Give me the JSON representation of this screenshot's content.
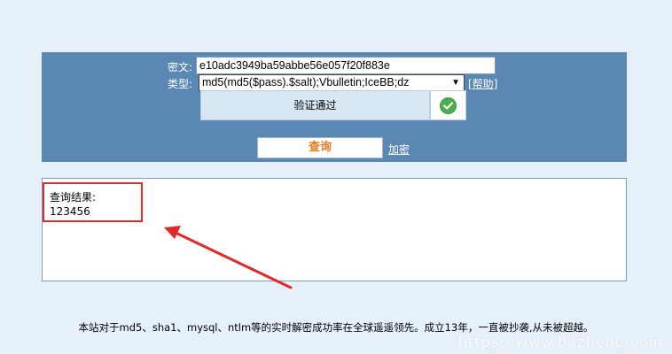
{
  "form": {
    "cipher_label": "密文:",
    "cipher_value": "e10adc3949ba59abbe56e057f20f883e",
    "type_label": "类型:",
    "type_value": "md5(md5($pass).$salt);Vbulletin;IceBB;dz",
    "help_link": "[帮助]",
    "verify_status": "验证通过",
    "query_button": "查询",
    "encrypt_link": "加密"
  },
  "result": {
    "label": "查询结果:",
    "value": "123456"
  },
  "footer": {
    "text": "本站对于md5、sha1、mysql、ntlm等的实时解密成功率在全球遥遥领先。成立13年，一直被抄袭,从未被超越。"
  },
  "watermark": "https://www.bazhepu.com",
  "colors": {
    "panel": "#5a87b3",
    "accent_orange": "#e97a1f",
    "success_green": "#4cae4c",
    "annotation_red": "#e02a2a"
  }
}
